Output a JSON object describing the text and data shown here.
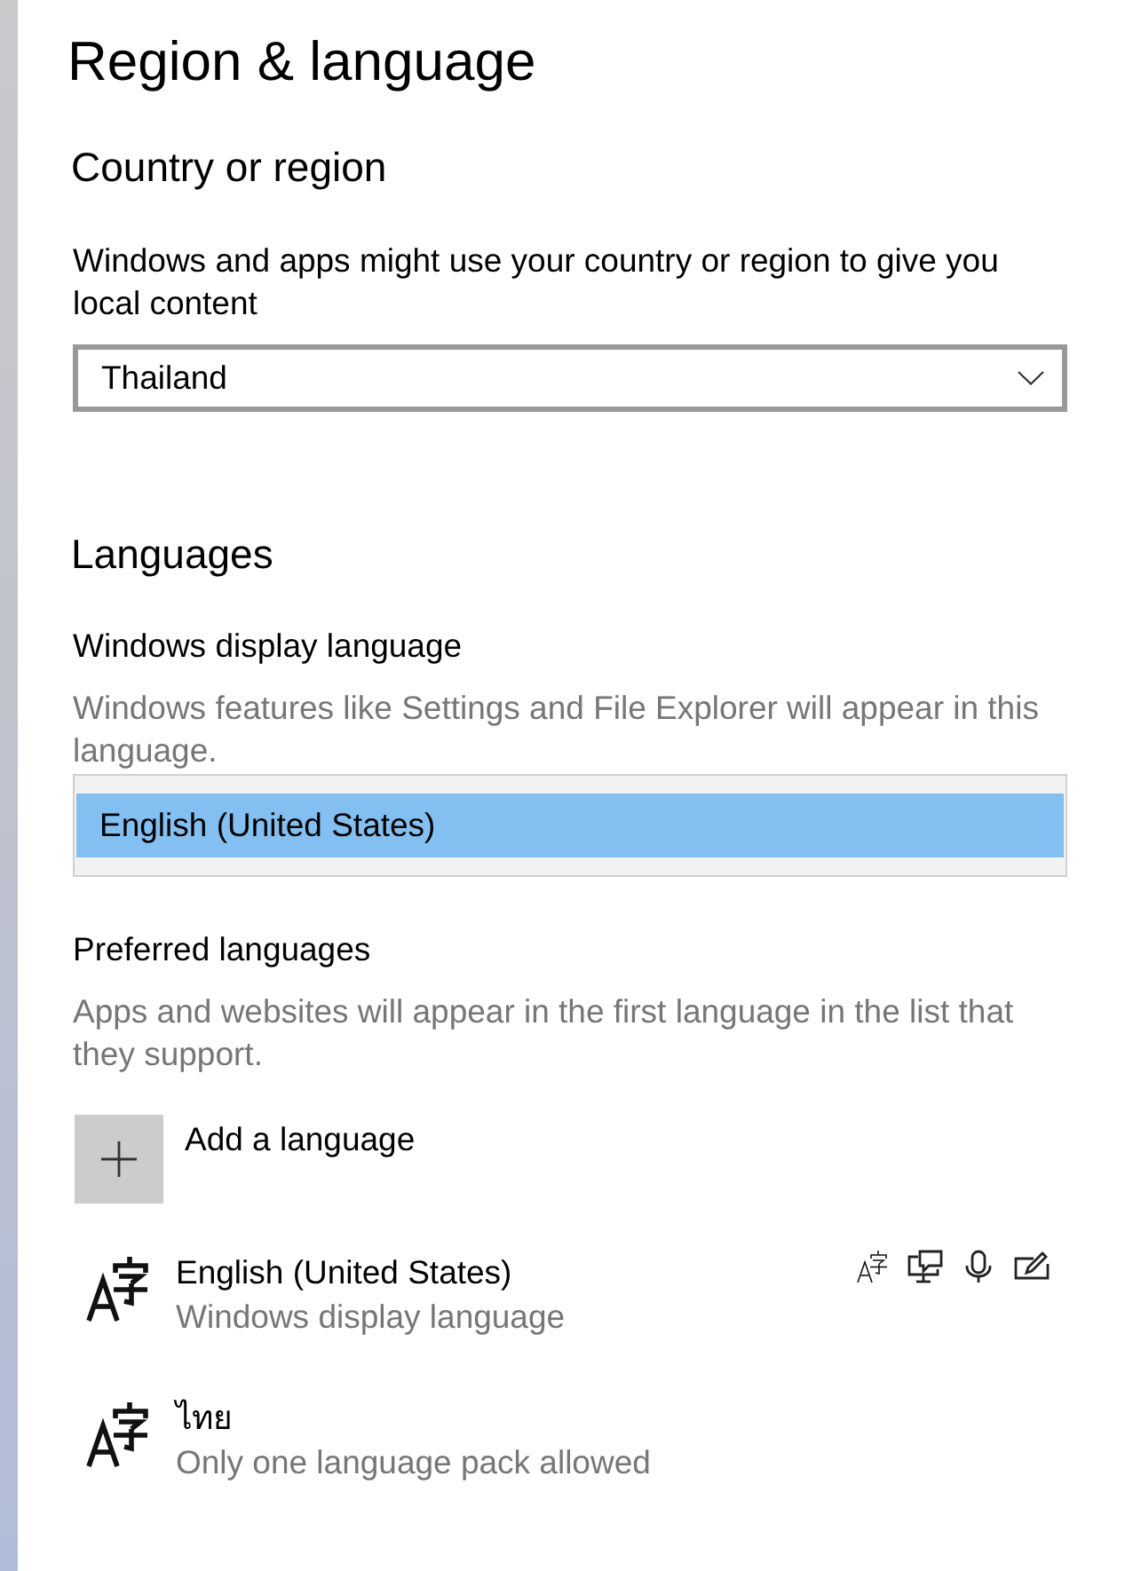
{
  "page": {
    "title": "Region & language"
  },
  "country_section": {
    "heading": "Country or region",
    "description": "Windows and apps might use your country or region to give you local content",
    "dropdown": {
      "value": "Thailand"
    }
  },
  "languages_section": {
    "heading": "Languages",
    "display_language": {
      "label": "Windows display language",
      "description": "Windows features like Settings and File Explorer will appear in this language.",
      "options": [
        {
          "label": "English (United States)",
          "selected": true
        }
      ]
    },
    "preferred": {
      "label": "Preferred languages",
      "description": "Apps and websites will appear in the first language in the list that they support.",
      "add_button": {
        "label": "Add a language"
      },
      "languages": [
        {
          "name": "English (United States)",
          "status": "Windows display language",
          "features": [
            {
              "kind": "language-pack"
            },
            {
              "kind": "display"
            },
            {
              "kind": "speech"
            },
            {
              "kind": "handwriting"
            }
          ]
        },
        {
          "name": "ไทย",
          "status": "Only one language pack allowed"
        }
      ]
    }
  }
}
